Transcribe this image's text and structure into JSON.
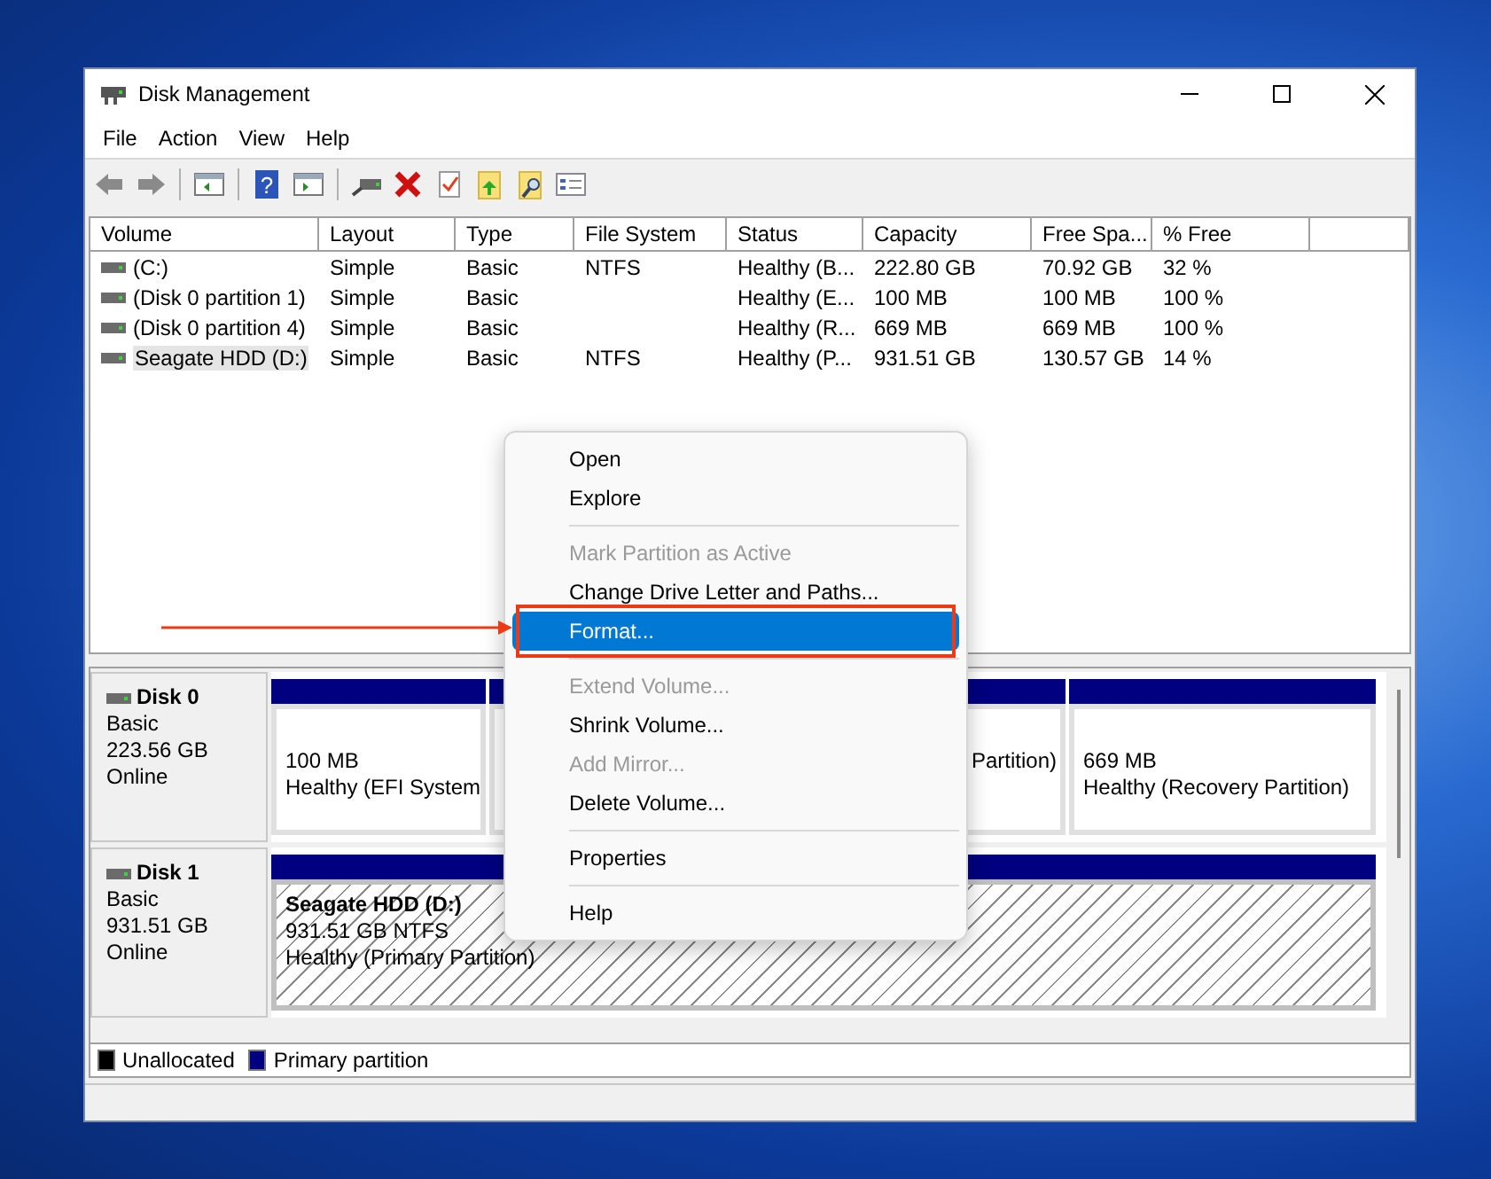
{
  "window": {
    "title": "Disk Management"
  },
  "menu_bar": [
    "File",
    "Action",
    "View",
    "Help"
  ],
  "toolbar": {
    "help_icon_text": "?"
  },
  "volume_table": {
    "columns": [
      "Volume",
      "Layout",
      "Type",
      "File System",
      "Status",
      "Capacity",
      "Free Spa...",
      "% Free"
    ],
    "rows": [
      {
        "cells": [
          "(C:)",
          "Simple",
          "Basic",
          "NTFS",
          "Healthy (B...",
          "222.80 GB",
          "70.92 GB",
          "32 %"
        ],
        "selected": false
      },
      {
        "cells": [
          "(Disk 0 partition 1)",
          "Simple",
          "Basic",
          "",
          "Healthy (E...",
          "100 MB",
          "100 MB",
          "100 %"
        ],
        "selected": false
      },
      {
        "cells": [
          "(Disk 0 partition 4)",
          "Simple",
          "Basic",
          "",
          "Healthy (R...",
          "669 MB",
          "669 MB",
          "100 %"
        ],
        "selected": false
      },
      {
        "cells": [
          "Seagate HDD (D:)",
          "Simple",
          "Basic",
          "NTFS",
          "Healthy (P...",
          "931.51 GB",
          "130.57 GB",
          "14 %"
        ],
        "selected": true
      }
    ]
  },
  "disks": [
    {
      "name": "Disk 0",
      "type": "Basic",
      "size": "223.56 GB",
      "status": "Online",
      "partitions": [
        {
          "lines": [
            "100 MB",
            "Healthy (EFI System"
          ],
          "selected": false
        },
        {
          "lines": [
            "Partition)"
          ],
          "selected": false
        },
        {
          "lines": [
            "669 MB",
            "Healthy (Recovery Partition)"
          ],
          "selected": false
        }
      ]
    },
    {
      "name": "Disk 1",
      "type": "Basic",
      "size": "931.51 GB",
      "status": "Online",
      "partitions": [
        {
          "label": "Seagate HDD  (D:)",
          "lines": [
            "931.51 GB NTFS",
            "Healthy (Primary Partition)"
          ],
          "selected": true
        }
      ]
    }
  ],
  "legend": [
    {
      "label": "Unallocated",
      "color": "#000000"
    },
    {
      "label": "Primary partition",
      "color": "#000080"
    }
  ],
  "context_menu": [
    {
      "kind": "item",
      "label": "Open",
      "disabled": false,
      "selected": false
    },
    {
      "kind": "item",
      "label": "Explore",
      "disabled": false,
      "selected": false
    },
    {
      "kind": "separator"
    },
    {
      "kind": "item",
      "label": "Mark Partition as Active",
      "disabled": true,
      "selected": false
    },
    {
      "kind": "item",
      "label": "Change Drive Letter and Paths...",
      "disabled": false,
      "selected": false
    },
    {
      "kind": "item",
      "label": "Format...",
      "disabled": false,
      "selected": true
    },
    {
      "kind": "separator"
    },
    {
      "kind": "item",
      "label": "Extend Volume...",
      "disabled": true,
      "selected": false
    },
    {
      "kind": "item",
      "label": "Shrink Volume...",
      "disabled": false,
      "selected": false
    },
    {
      "kind": "item",
      "label": "Add Mirror...",
      "disabled": true,
      "selected": false
    },
    {
      "kind": "item",
      "label": "Delete Volume...",
      "disabled": false,
      "selected": false
    },
    {
      "kind": "separator"
    },
    {
      "kind": "item",
      "label": "Properties",
      "disabled": false,
      "selected": false
    },
    {
      "kind": "separator"
    },
    {
      "kind": "item",
      "label": "Help",
      "disabled": false,
      "selected": false
    }
  ]
}
